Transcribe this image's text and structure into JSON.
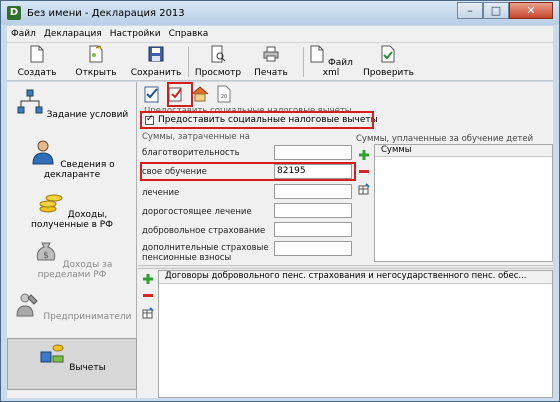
{
  "window": {
    "app_icon": "D",
    "title": "Без имени - Декларация 2013"
  },
  "menu": [
    "Файл",
    "Декларация",
    "Настройки",
    "Справка"
  ],
  "toolbar": {
    "create": "Создать",
    "open": "Открыть",
    "save": "Сохранить",
    "preview": "Просмотр",
    "print": "Печать",
    "xml": "Файл xml",
    "check": "Проверить"
  },
  "sidebar": {
    "items": [
      {
        "label": "Задание условий",
        "icon": "network-icon"
      },
      {
        "label": "Сведения о декларанте",
        "icon": "person-icon"
      },
      {
        "label": "Доходы, полученные в РФ",
        "icon": "coins-icon"
      },
      {
        "label": "Доходы за пределами РФ",
        "icon": "money-bag-icon"
      },
      {
        "label": "Предприниматели",
        "icon": "worker-icon"
      },
      {
        "label": "Вычеты",
        "icon": "scales-icon"
      }
    ]
  },
  "content": {
    "hidden_header": "Предоставить социальные налоговые вычеты",
    "checkbox_label": "Предоставить социальные налоговые вычеты",
    "expense_title": "Суммы, затраченные на",
    "fields": [
      {
        "label": "благотворительность",
        "value": ""
      },
      {
        "label": "свое обучение",
        "value": "82195"
      },
      {
        "label": "лечение",
        "value": ""
      },
      {
        "label": "дорогостоящее лечение",
        "value": ""
      },
      {
        "label": "добровольное страхование",
        "value": ""
      },
      {
        "label": "дополнительные страховые пенсионные взносы",
        "value": ""
      }
    ],
    "children_title": "Суммы, уплаченные за обучение детей",
    "children_column": "Суммы",
    "contracts_column": "Договоры добровольного пенс. страхования и негосударственного пенс. обес..."
  },
  "colors": {
    "highlight": "#d41e1e",
    "accent_green": "#2f8f2f"
  }
}
